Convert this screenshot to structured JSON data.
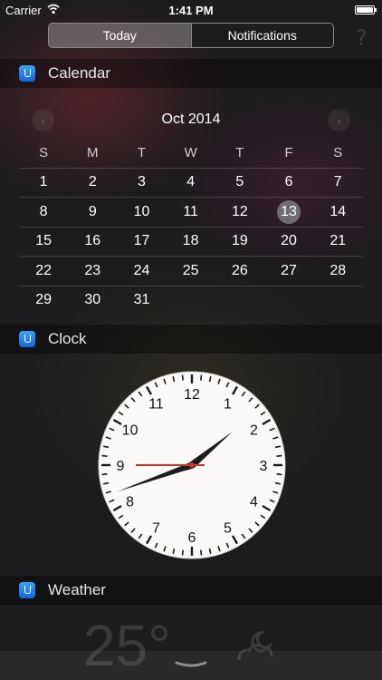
{
  "status_bar": {
    "carrier": "Carrier",
    "time": "1:41 PM"
  },
  "tabs": [
    {
      "label": "Today",
      "active": true
    },
    {
      "label": "Notifications",
      "active": false
    }
  ],
  "help_icon": "?",
  "calendar": {
    "title": "Calendar",
    "month": "Oct 2014",
    "prev_icon": "‹",
    "next_icon": "›",
    "weekdays": [
      "S",
      "M",
      "T",
      "W",
      "T",
      "F",
      "S"
    ],
    "weeks": [
      [
        "",
        "1",
        "2",
        "3",
        "4",
        "5",
        "6",
        "7"
      ],
      [
        "8",
        "9",
        "10",
        "11",
        "12",
        "13",
        "14"
      ],
      [
        "15",
        "16",
        "17",
        "18",
        "19",
        "20",
        "21"
      ],
      [
        "22",
        "23",
        "24",
        "25",
        "26",
        "27",
        "28"
      ],
      [
        "29",
        "30",
        "31",
        "",
        "",
        "",
        ""
      ]
    ],
    "today": "13"
  },
  "clock": {
    "title": "Clock",
    "numbers": [
      "12",
      "1",
      "2",
      "3",
      "4",
      "5",
      "6",
      "7",
      "8",
      "9",
      "10",
      "11"
    ],
    "hour": 13,
    "minute": 41,
    "second": 45,
    "second_hand_color": "#c0392b"
  },
  "weather": {
    "title": "Weather",
    "temperature": "25°"
  },
  "colors": {
    "accent_icon": "#2d8cf0"
  }
}
